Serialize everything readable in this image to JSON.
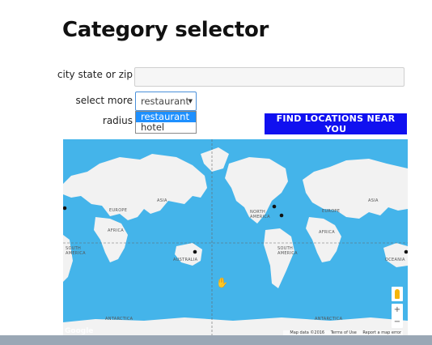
{
  "page": {
    "title": "Category selector"
  },
  "form": {
    "city_label": "city state or zip",
    "city_value": "",
    "select_label": "select more",
    "select_value": "restaurant",
    "select_options": [
      "restaurant",
      "hotel"
    ],
    "radius_label": "radius",
    "find_button": "FIND LOCATIONS NEAR YOU"
  },
  "map": {
    "labels": {
      "asia_left": "ASIA",
      "europe_left": "EUROPE",
      "africa_left": "AFRICA",
      "south_america_left": "SOUTH AMERICA",
      "antarctica_left": "ANTARCTICA",
      "north_america": "NORTH AMERICA",
      "south_america": "SOUTH AMERICA",
      "australia": "AUSTRALIA",
      "asia_right": "ASIA",
      "europe_right": "EUROPE",
      "africa_right": "AFRICA",
      "oceania": "OCEANIA",
      "antarctica_right": "ANTARCTICA"
    },
    "footer": {
      "data": "Map data ©2016",
      "terms": "Terms of Use",
      "report": "Report a map error"
    },
    "google": "Google",
    "zoom_in": "+",
    "zoom_out": "−",
    "colors": {
      "water": "#44b4ea",
      "land": "#f2f2f2",
      "marker": "#111111",
      "button": "#1010f0"
    }
  }
}
